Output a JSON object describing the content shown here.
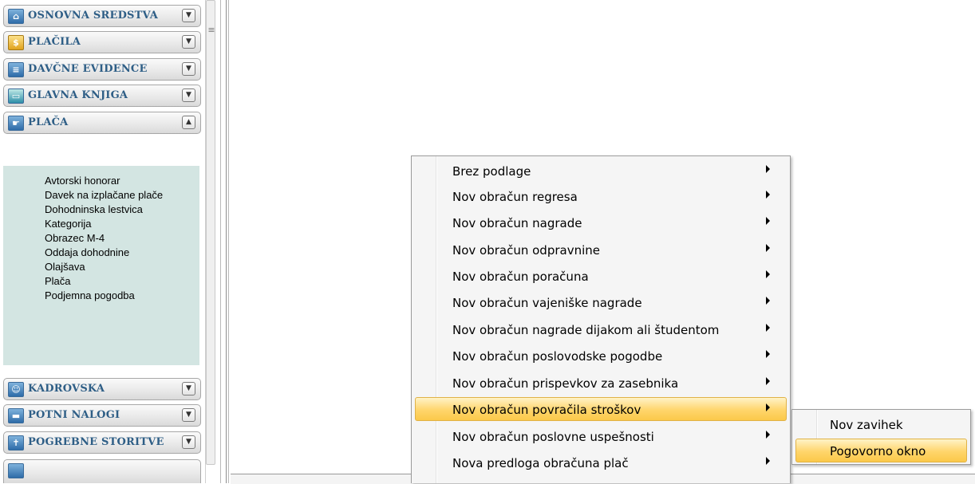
{
  "sidebar": {
    "sections": [
      {
        "label": "OSNOVNA SREDSTVA",
        "icon": "building-icon",
        "toggle": "chevron-down"
      },
      {
        "label": "PLAČILA",
        "icon": "money-bag-icon",
        "toggle": "chevron-down"
      },
      {
        "label": "DAVČNE EVIDENCE",
        "icon": "tax-records-icon",
        "toggle": "chevron-down"
      },
      {
        "label": "GLAVNA KNJIGA",
        "icon": "ledger-icon",
        "toggle": "chevron-down"
      },
      {
        "label": "PLAČA",
        "icon": "salary-icon",
        "toggle": "chevron-up"
      },
      {
        "label": "KADROVSKA",
        "icon": "personnel-icon",
        "toggle": "chevron-down"
      },
      {
        "label": "POTNI NALOGI",
        "icon": "car-icon",
        "toggle": "chevron-down"
      },
      {
        "label": "POGREBNE STORITVE",
        "icon": "funeral-icon",
        "toggle": "chevron-down"
      }
    ],
    "submenu_items": [
      "Avtorski honorar",
      "Davek na izplačane plače",
      "Dohodninska lestvica",
      "Kategorija",
      "Obrazec M-4",
      "Oddaja dohodnine",
      "Olajšava",
      "Plača",
      "Podjemna pogodba"
    ]
  },
  "context_menu": {
    "items": [
      {
        "label": "Brez podlage",
        "has_submenu": true
      },
      {
        "label": "Nov obračun regresa",
        "has_submenu": true
      },
      {
        "label": "Nov obračun nagrade",
        "has_submenu": true
      },
      {
        "label": "Nov obračun odpravnine",
        "has_submenu": true
      },
      {
        "label": "Nov obračun poračuna",
        "has_submenu": true
      },
      {
        "label": "Nov obračun vajeniške nagrade",
        "has_submenu": true
      },
      {
        "label": "Nov obračun nagrade dijakom ali študentom",
        "has_submenu": true
      },
      {
        "label": "Nov obračun poslovodske pogodbe",
        "has_submenu": true
      },
      {
        "label": "Nov obračun prispevkov za zasebnika",
        "has_submenu": true
      },
      {
        "label": "Nov obračun povračila stroškov",
        "has_submenu": true,
        "highlighted": true
      },
      {
        "label": "Nov obračun poslovne uspešnosti",
        "has_submenu": true
      },
      {
        "label": "Nova predloga obračuna plač",
        "has_submenu": true
      }
    ]
  },
  "sub_popup": {
    "items": [
      {
        "label": "Nov zavihek"
      },
      {
        "label": "Pogovorno okno",
        "highlighted": true
      }
    ]
  },
  "colors": {
    "section_label": "#2e5e86",
    "submenu_background": "#d3e5e2",
    "highlight": "#ffd56b",
    "highlight_border": "#e0b247"
  }
}
